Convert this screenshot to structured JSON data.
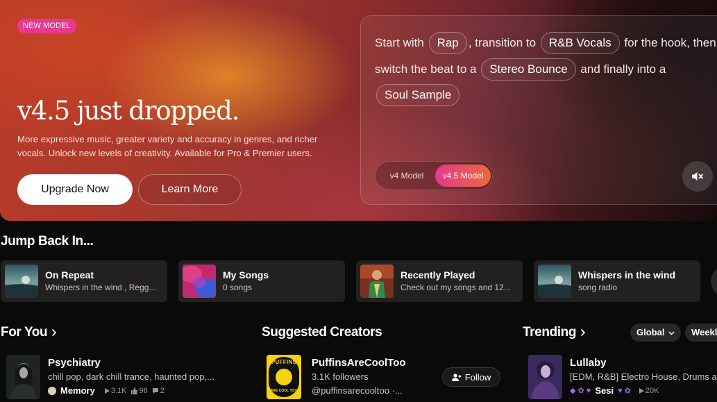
{
  "hero": {
    "badge": "NEW MODEL",
    "title": "v4.5 just dropped.",
    "description": "More expressive music, greater variety and accuracy in genres, and richer vocals. Unlock new levels of creativity. Available for Pro & Premier users.",
    "upgrade_label": "Upgrade Now",
    "learn_label": "Learn More",
    "prompt": {
      "t1": "Start with",
      "chip1": "Rap",
      "t2": ", transition to",
      "chip2": "R&B Vocals",
      "t3": "for the hook, then switch the beat to a",
      "chip3": "Stereo Bounce",
      "t4": "and finally into a",
      "chip4": "Soul Sample"
    },
    "model_v4": "v4 Model",
    "model_v45": "v4.5 Model",
    "active_model": "v4.5 Model"
  },
  "jump_back": {
    "heading": "Jump Back In...",
    "cards": [
      {
        "title": "On Repeat",
        "subtitle": "Whispers in the wind , Reggae..."
      },
      {
        "title": "My Songs",
        "subtitle": "0 songs"
      },
      {
        "title": "Recently Played",
        "subtitle": "Check out my songs and 12..."
      },
      {
        "title": "Whispers in the wind",
        "subtitle": "song radio"
      }
    ]
  },
  "for_you": {
    "heading": "For You",
    "item": {
      "title": "Psychiatry",
      "tags": "chill pop, dark chill trance, haunted pop,...",
      "artist": "Memory",
      "plays": "3.1K",
      "likes": "96",
      "comments": "2"
    }
  },
  "suggested": {
    "heading": "Suggested Creators",
    "creator": {
      "name": "PuffinsAreCoolToo",
      "followers": "3.1K followers",
      "handle": "@puffinsarecooltoo ·...",
      "follow_label": "Follow",
      "avatar_text_top": "PUFFINS",
      "avatar_text_bottom": "ARE COOL TOO"
    }
  },
  "trending": {
    "heading": "Trending",
    "filter_global": "Global",
    "filter_weekly": "Weekl",
    "item": {
      "title": "Lullaby",
      "tags": "[EDM, R&B] Electro House, Drums a",
      "artist": "Sesi",
      "plays": "20K"
    }
  }
}
